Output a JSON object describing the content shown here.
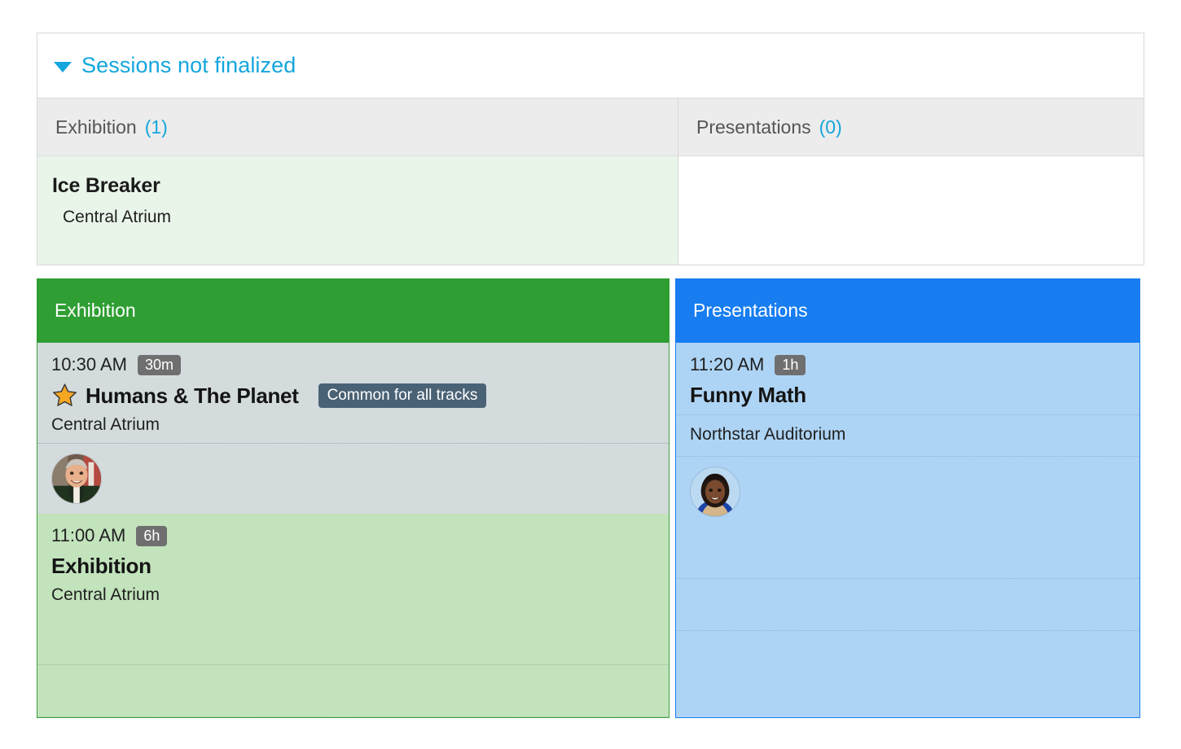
{
  "not_finalized": {
    "title": "Sessions not finalized",
    "caret": "chevron-down-icon",
    "columns": [
      {
        "label": "Exhibition",
        "count": "(1)",
        "sessions": [
          {
            "title": "Ice Breaker",
            "room": "Central Atrium"
          }
        ]
      },
      {
        "label": "Presentations",
        "count": "(0)",
        "sessions": []
      }
    ]
  },
  "tracks": [
    {
      "name": "Exhibition",
      "header_color": "#2f9e33",
      "sessions": [
        {
          "time": "10:30 AM",
          "duration": "30m",
          "title": "Humans & The Planet",
          "room": "Central Atrium",
          "starred": true,
          "tag": "Common for all tracks",
          "speakers": [
            {
              "name": "speaker-avatar-1"
            }
          ]
        },
        {
          "time": "11:00 AM",
          "duration": "6h",
          "title": "Exhibition",
          "room": "Central Atrium",
          "starred": false,
          "tag": "",
          "speakers": []
        }
      ]
    },
    {
      "name": "Presentations",
      "header_color": "#177df1",
      "sessions": [
        {
          "time": "11:20 AM",
          "duration": "1h",
          "title": "Funny Math",
          "room": "Northstar Auditorium",
          "starred": false,
          "tag": "",
          "speakers": [
            {
              "name": "speaker-avatar-2"
            }
          ]
        }
      ]
    }
  ],
  "colors": {
    "accent_blue": "#14a6dd",
    "track_green": "#2f9e33",
    "track_blue": "#177df1",
    "badge_grey": "#6f6f6f",
    "tag_slate": "#4a6275",
    "star_orange": "#f5a623"
  }
}
